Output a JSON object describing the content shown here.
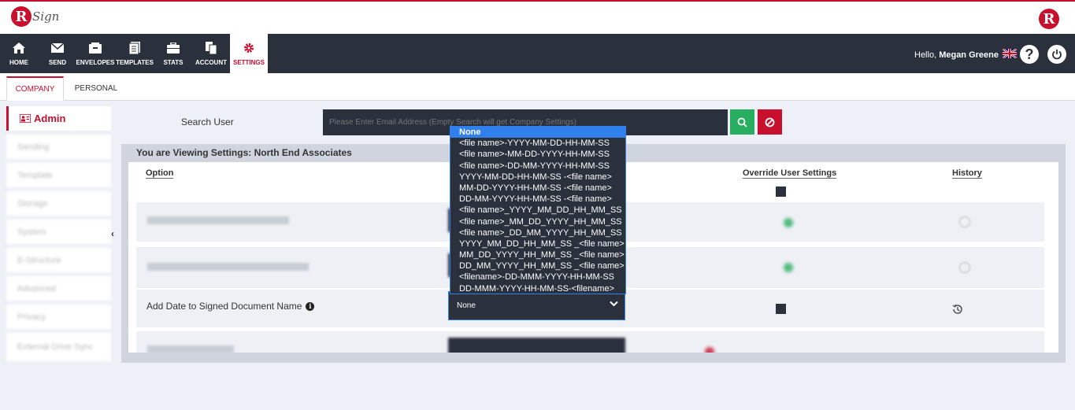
{
  "brand": {
    "logo_letter": "R",
    "logo_word": "Sign"
  },
  "nav": {
    "items": [
      {
        "label": "HOME",
        "icon": "home-icon"
      },
      {
        "label": "SEND",
        "icon": "envelope-icon"
      },
      {
        "label": "ENVELOPES",
        "icon": "inbox-icon"
      },
      {
        "label": "TEMPLATES",
        "icon": "document-icon"
      },
      {
        "label": "STATS",
        "icon": "briefcase-icon"
      },
      {
        "label": "ACCOUNT",
        "icon": "copy-icon"
      },
      {
        "label": "SETTINGS",
        "icon": "gear-icon"
      }
    ],
    "active": "SETTINGS"
  },
  "user": {
    "hello": "Hello,",
    "name": "Megan Greene"
  },
  "tabs": {
    "company": "COMPANY",
    "personal": "PERSONAL"
  },
  "sidebar": {
    "items": [
      "Admin",
      "Sending",
      "Template",
      "Storage",
      "System",
      "E-Structure",
      "Advanced",
      "Privacy",
      "External Drive Sync"
    ]
  },
  "search": {
    "label": "Search User",
    "placeholder": "Please Enter Email Address (Empty Search will get Company Settings)"
  },
  "panel": {
    "title": "You are Viewing Settings: North End Associates",
    "columns": {
      "option": "Option",
      "override": "Override User Settings",
      "history": "History"
    },
    "row_label": "Add Date to Signed Document Name",
    "selected_value": "None"
  },
  "dropdown": {
    "options": [
      "None",
      "<file name>-YYYY-MM-DD-HH-MM-SS",
      "<file name>-MM-DD-YYYY-HH-MM-SS",
      "<file name>-DD-MM-YYYY-HH-MM-SS",
      "YYYY-MM-DD-HH-MM-SS -<file name>",
      "MM-DD-YYYY-HH-MM-SS -<file name>",
      "DD-MM-YYYY-HH-MM-SS -<file name>",
      "<file name>_YYYY_MM_DD_HH_MM_SS",
      "<file name>_MM_DD_YYYY_HH_MM_SS",
      "<file name>_DD_MM_YYYY_HH_MM_SS",
      "YYYY_MM_DD_HH_MM_SS _<file name>",
      "MM_DD_YYYY_HH_MM_SS _<file name>",
      "DD_MM_YYYY_HH_MM_SS _<file name>",
      "<filename>-DD-MMM-YYYY-HH-MM-SS",
      "DD-MMM-YYYY-HH-MM-SS-<filename>"
    ],
    "selected_index": 0
  },
  "colors": {
    "brand_red": "#c8102e",
    "nav_dark": "#2a303c",
    "accent_blue": "#2f80ed",
    "green": "#27ae60"
  }
}
